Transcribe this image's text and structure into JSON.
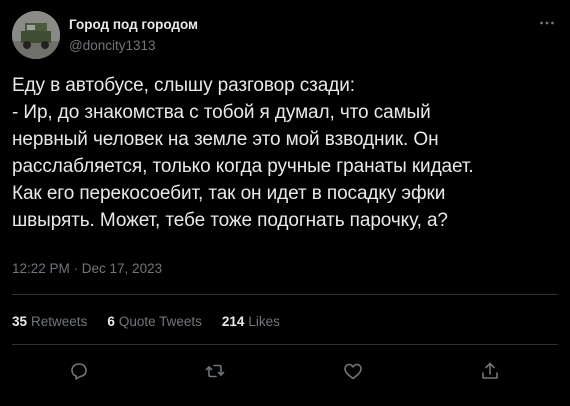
{
  "author": {
    "name": "Город под городом",
    "handle": "@doncity1313"
  },
  "tweet": {
    "text": "Еду в автобусе, слышу разговор сзади:\n- Ир, до знакомства с тобой я думал, что самый\nнервный человек на земле это мой взводник. Он\nрасслабляется, только когда ручные гранаты кидает.\nКак его перекосоебит, так он идет в посадку эфки\nшвырять. Может, тебе тоже подогнать парочку, а?",
    "timestamp": "12:22 PM · Dec 17, 2023"
  },
  "stats": {
    "retweets_count": "35",
    "retweets_label": "Retweets",
    "quotes_count": "6",
    "quotes_label": "Quote Tweets",
    "likes_count": "214",
    "likes_label": "Likes"
  },
  "icons": {
    "more": "more-horizontal-icon",
    "reply": "reply-icon",
    "retweet": "retweet-icon",
    "like": "heart-icon",
    "share": "share-icon"
  },
  "colors": {
    "background": "#000000",
    "text_primary": "#e7e9ea",
    "text_secondary": "#71767b",
    "divider": "#2f3336"
  }
}
